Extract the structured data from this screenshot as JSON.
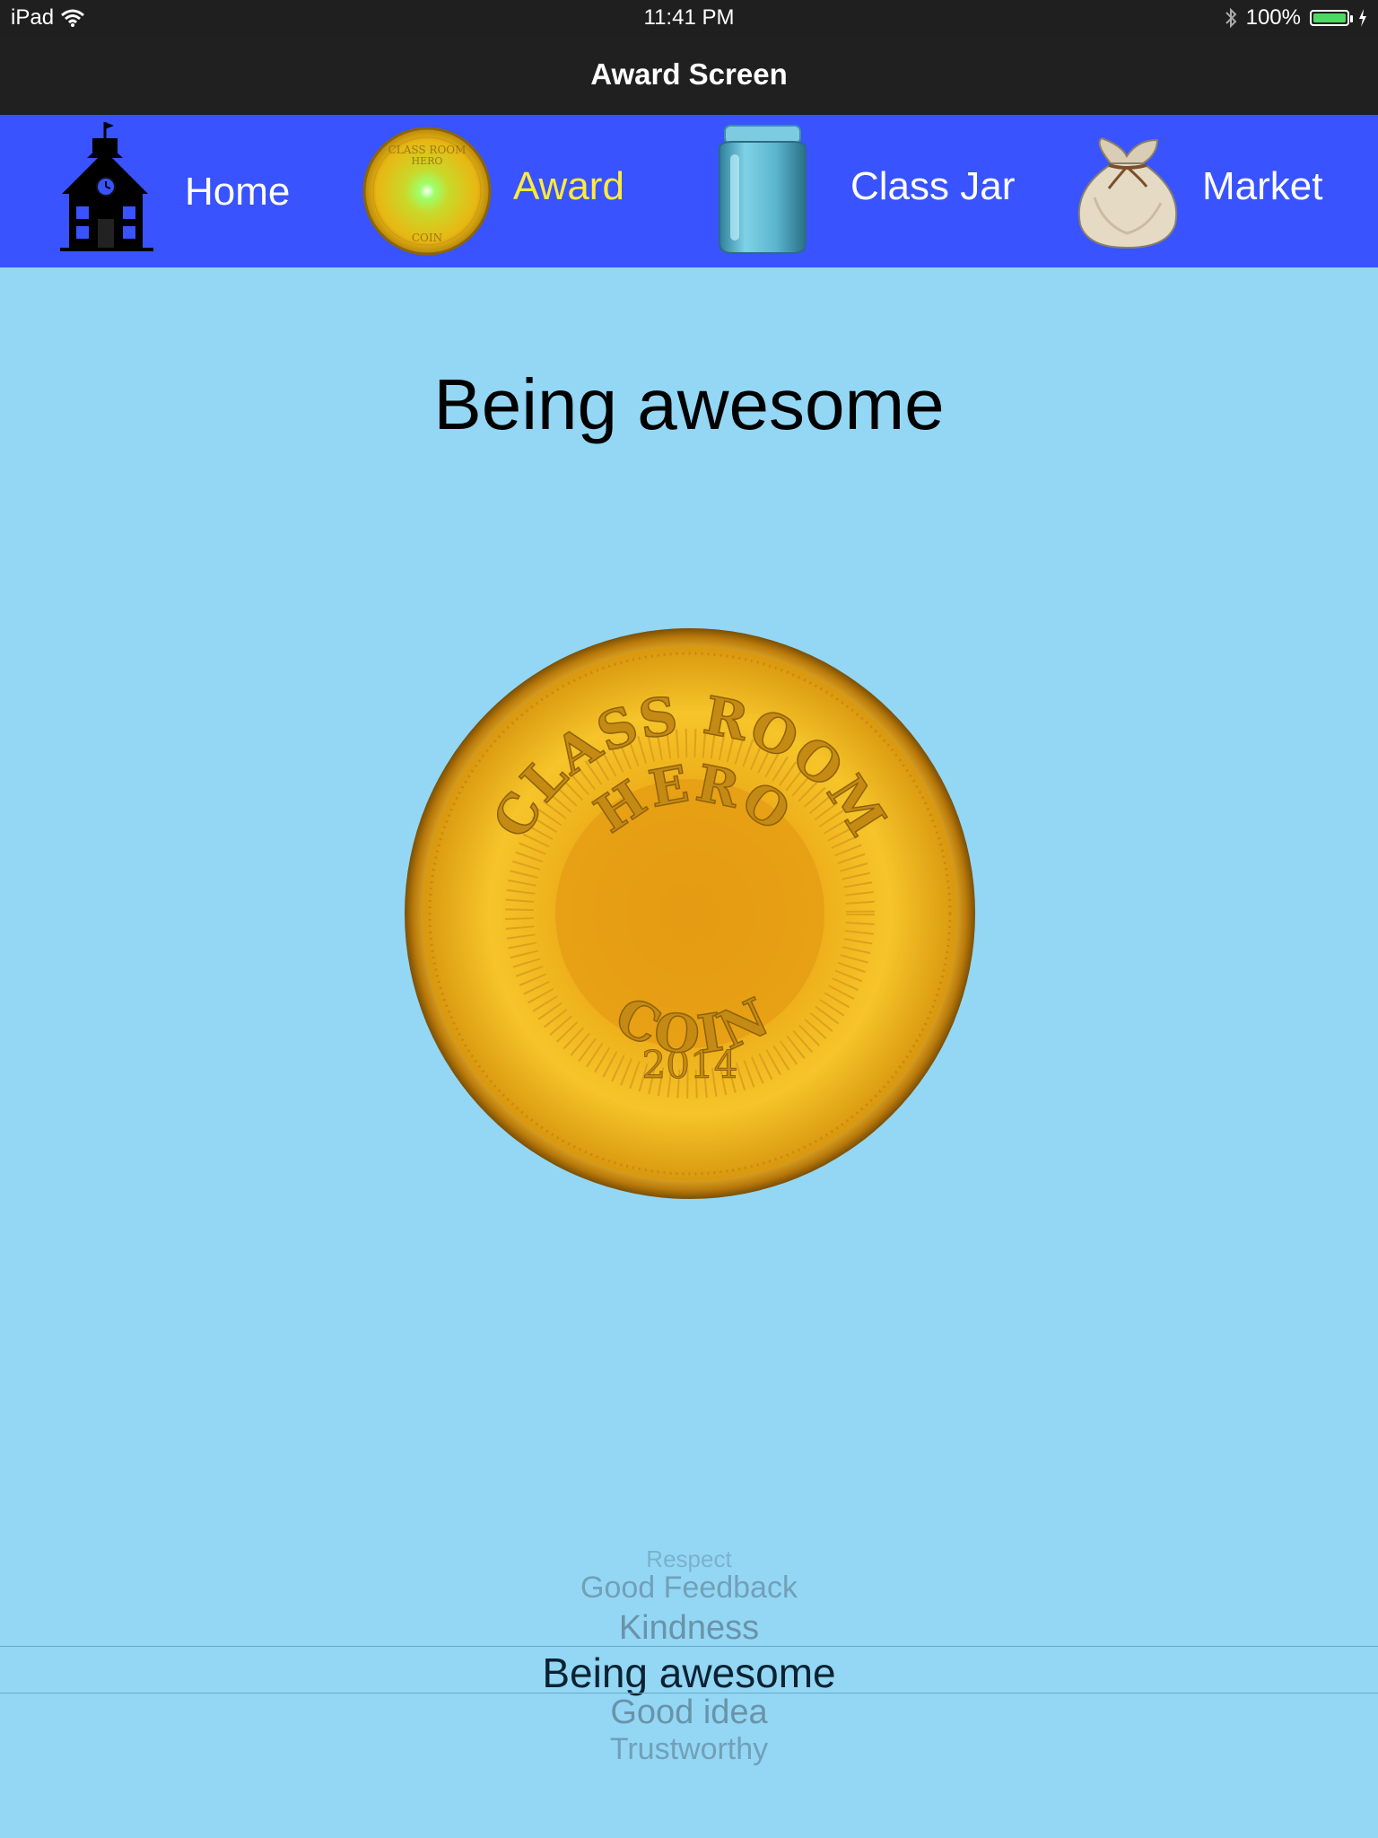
{
  "status_bar": {
    "device": "iPad",
    "time": "11:41 PM",
    "battery": "100%",
    "battery_level": 1.0,
    "icons": [
      "wifi-icon",
      "bluetooth-icon",
      "battery-icon",
      "charging-icon"
    ]
  },
  "nav": {
    "title": "Award Screen"
  },
  "tabs": [
    {
      "label": "Home",
      "icon": "schoolhouse-icon",
      "active": false
    },
    {
      "label": "Award",
      "icon": "coin-icon",
      "active": true
    },
    {
      "label": "Class Jar",
      "icon": "jar-icon",
      "active": false
    },
    {
      "label": "Market",
      "icon": "sack-icon",
      "active": false
    }
  ],
  "award": {
    "title": "Being awesome",
    "coin": {
      "top_text": "CLASS ROOM",
      "middle_text": "HERO",
      "year": "2014",
      "bottom_text": "COIN",
      "small_top": "CLASS ROOM",
      "small_middle": "HERO",
      "small_bottom": "COIN"
    }
  },
  "picker": {
    "options": [
      "Respect",
      "Good Feedback",
      "Kindness",
      "Being awesome",
      "Good idea",
      "Trustworthy"
    ],
    "selected": "Being awesome"
  },
  "colors": {
    "background": "#93d7f5",
    "tab_bar": "#3853ff",
    "active_tab_label": "#ffeb3b",
    "status_bar": "#1f1f1f"
  }
}
